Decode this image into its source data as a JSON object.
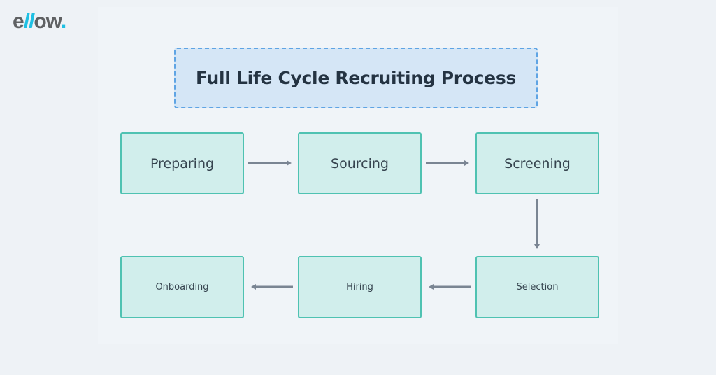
{
  "brand": {
    "logo_prefix": "e",
    "logo_accent": "ll",
    "logo_suffix": "ow",
    "logo_dot": ".",
    "accent_color": "#1fc0e3",
    "text_color": "#5f6163"
  },
  "diagram": {
    "title": "Full Life Cycle Recruiting Process",
    "nodes": [
      {
        "id": "preparing",
        "label": "Preparing"
      },
      {
        "id": "sourcing",
        "label": "Sourcing"
      },
      {
        "id": "screening",
        "label": "Screening"
      },
      {
        "id": "selection",
        "label": "Selection"
      },
      {
        "id": "hiring",
        "label": "Hiring"
      },
      {
        "id": "onboarding",
        "label": "Onboarding"
      }
    ],
    "edges": [
      {
        "from": "preparing",
        "to": "sourcing"
      },
      {
        "from": "sourcing",
        "to": "screening"
      },
      {
        "from": "screening",
        "to": "selection"
      },
      {
        "from": "selection",
        "to": "hiring"
      },
      {
        "from": "hiring",
        "to": "onboarding"
      }
    ],
    "colors": {
      "node_fill": "#d1eeec",
      "node_border": "#4fc2b2",
      "title_fill": "#d5e6f6",
      "title_border": "#5fa4e4",
      "arrow": "#7a8593"
    }
  }
}
